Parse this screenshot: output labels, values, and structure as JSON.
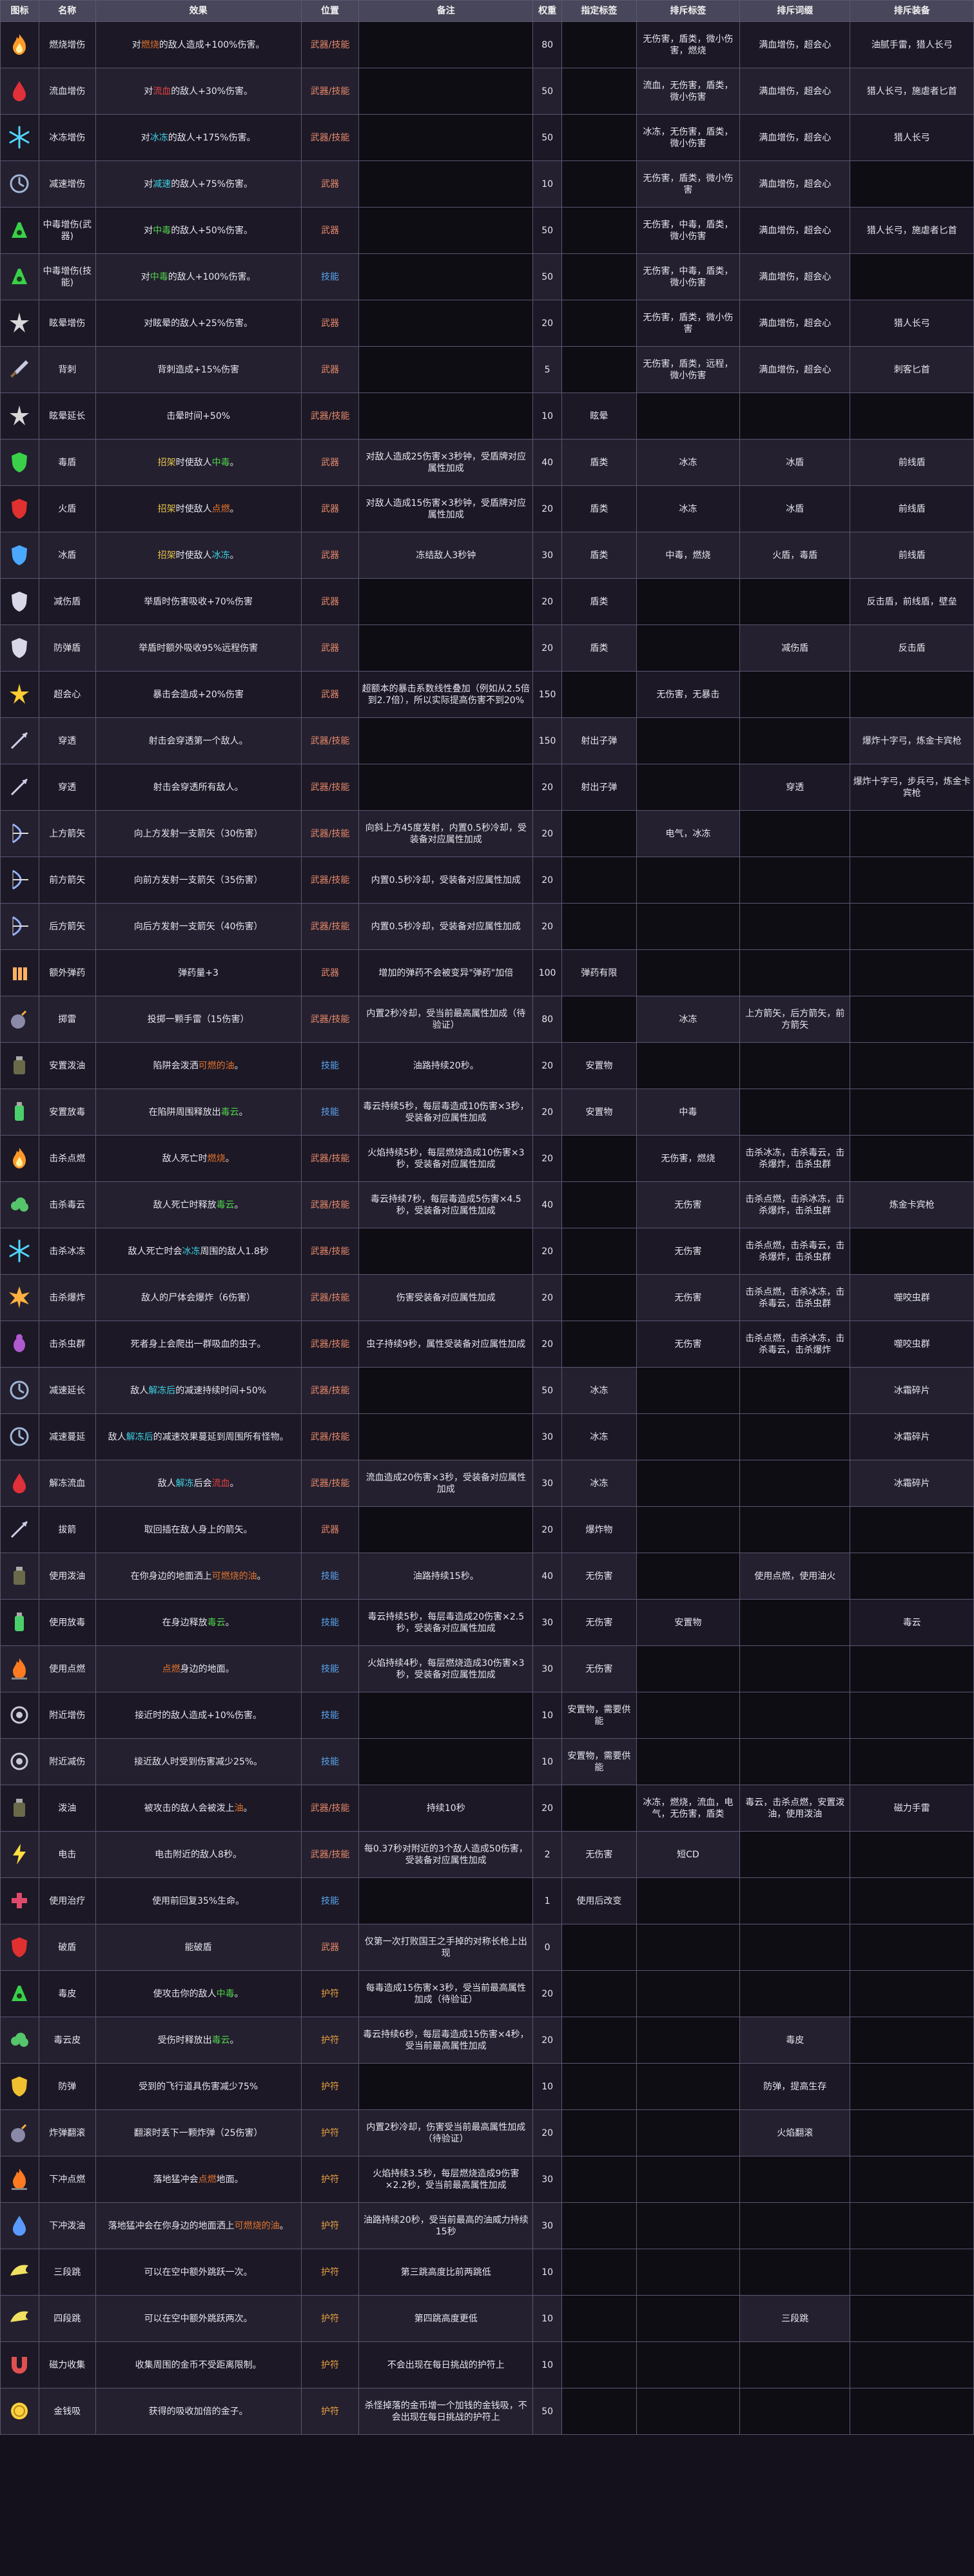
{
  "headers": [
    "图标",
    "名称",
    "效果",
    "位置",
    "备注",
    "权重",
    "指定标签",
    "排斥标签",
    "排斥词缀",
    "排斥装备"
  ],
  "rows": [
    {
      "name": "燃烧增伤",
      "effect": [
        [
          "对",
          ""
        ],
        [
          "燃烧",
          "hl-orange"
        ],
        [
          "的敌人造成+100%伤害。",
          ""
        ]
      ],
      "loc": "武器/技能",
      "note": "",
      "weight": "80",
      "tag": "",
      "ex_tag": "无伤害，盾类，微小伤害，燃烧",
      "ex_affix": "满血增伤，超会心",
      "ex_equip": "油腻手雷，猎人长弓",
      "icon": "flame"
    },
    {
      "name": "流血增伤",
      "effect": [
        [
          "对",
          ""
        ],
        [
          "流血",
          "hl-red"
        ],
        [
          "的敌人+30%伤害。",
          ""
        ]
      ],
      "loc": "武器/技能",
      "note": "",
      "weight": "50",
      "tag": "",
      "ex_tag": "流血，无伤害，盾类，微小伤害",
      "ex_affix": "满血增伤，超会心",
      "ex_equip": "猎人长弓，施虐者匕首",
      "icon": "blood"
    },
    {
      "name": "冰冻增伤",
      "effect": [
        [
          "对",
          ""
        ],
        [
          "冰冻",
          "hl-cyan"
        ],
        [
          "的敌人+175%伤害。",
          ""
        ]
      ],
      "loc": "武器/技能",
      "note": "",
      "weight": "50",
      "tag": "",
      "ex_tag": "冰冻，无伤害，盾类，微小伤害",
      "ex_affix": "满血增伤，超会心",
      "ex_equip": "猎人长弓",
      "icon": "ice"
    },
    {
      "name": "减速增伤",
      "effect": [
        [
          "对",
          ""
        ],
        [
          "减速",
          "hl-cyan"
        ],
        [
          "的敌人+75%伤害。",
          ""
        ]
      ],
      "loc": "武器",
      "note": "",
      "weight": "10",
      "tag": "",
      "ex_tag": "无伤害，盾类，微小伤害",
      "ex_affix": "满血增伤，超会心",
      "ex_equip": "",
      "icon": "slow"
    },
    {
      "name": "中毒增伤(武器)",
      "effect": [
        [
          "对",
          ""
        ],
        [
          "中毒",
          "hl-green"
        ],
        [
          "的敌人+50%伤害。",
          ""
        ]
      ],
      "loc": "武器",
      "note": "",
      "weight": "50",
      "tag": "",
      "ex_tag": "无伤害，中毒，盾类，微小伤害",
      "ex_affix": "满血增伤，超会心",
      "ex_equip": "猎人长弓，施虐者匕首",
      "icon": "poison"
    },
    {
      "name": "中毒增伤(技能)",
      "effect": [
        [
          "对",
          ""
        ],
        [
          "中毒",
          "hl-green"
        ],
        [
          "的敌人+100%伤害。",
          ""
        ]
      ],
      "loc": "技能",
      "note": "",
      "weight": "50",
      "tag": "",
      "ex_tag": "无伤害，中毒，盾类，微小伤害",
      "ex_affix": "满血增伤，超会心",
      "ex_equip": "",
      "icon": "poison"
    },
    {
      "name": "眩晕增伤",
      "effect": [
        [
          "对眩晕的敌人+25%伤害。",
          ""
        ]
      ],
      "loc": "武器",
      "note": "",
      "weight": "20",
      "tag": "",
      "ex_tag": "无伤害，盾类，微小伤害",
      "ex_affix": "满血增伤，超会心",
      "ex_equip": "猎人长弓",
      "icon": "stun"
    },
    {
      "name": "背刺",
      "effect": [
        [
          "背刺造成+15%伤害",
          ""
        ]
      ],
      "loc": "武器",
      "note": "",
      "weight": "5",
      "tag": "",
      "ex_tag": "无伤害，盾类，远程，微小伤害",
      "ex_affix": "满血增伤，超会心",
      "ex_equip": "刺客匕首",
      "icon": "dagger"
    },
    {
      "name": "眩晕延长",
      "effect": [
        [
          "击晕时间+50%",
          ""
        ]
      ],
      "loc": "武器/技能",
      "note": "",
      "weight": "10",
      "tag": "眩晕",
      "ex_tag": "",
      "ex_affix": "",
      "ex_equip": "",
      "icon": "stun"
    },
    {
      "name": "毒盾",
      "effect": [
        [
          "招架",
          "hl-yellow"
        ],
        [
          "时使敌人",
          ""
        ],
        [
          "中毒",
          "hl-green"
        ],
        [
          "。",
          ""
        ]
      ],
      "loc": "武器",
      "note": "对敌人造成25伤害×3秒钟，受盾牌对应属性加成",
      "weight": "40",
      "tag": "盾类",
      "ex_tag": "冰冻",
      "ex_affix": "冰盾",
      "ex_equip": "前线盾",
      "icon": "shield-g"
    },
    {
      "name": "火盾",
      "effect": [
        [
          "招架",
          "hl-yellow"
        ],
        [
          "时使敌人",
          ""
        ],
        [
          "点燃",
          "hl-orange"
        ],
        [
          "。",
          ""
        ]
      ],
      "loc": "武器",
      "note": "对敌人造成15伤害×3秒钟，受盾牌对应属性加成",
      "weight": "20",
      "tag": "盾类",
      "ex_tag": "冰冻",
      "ex_affix": "冰盾",
      "ex_equip": "前线盾",
      "icon": "shield-r"
    },
    {
      "name": "冰盾",
      "effect": [
        [
          "招架",
          "hl-yellow"
        ],
        [
          "时使敌人",
          ""
        ],
        [
          "冰冻",
          "hl-cyan"
        ],
        [
          "。",
          ""
        ]
      ],
      "loc": "武器",
      "note": "冻结敌人3秒钟",
      "weight": "30",
      "tag": "盾类",
      "ex_tag": "中毒，燃烧",
      "ex_affix": "火盾，毒盾",
      "ex_equip": "前线盾",
      "icon": "shield-b"
    },
    {
      "name": "减伤盾",
      "effect": [
        [
          "举盾时伤害吸收+70%伤害",
          ""
        ]
      ],
      "loc": "武器",
      "note": "",
      "weight": "20",
      "tag": "盾类",
      "ex_tag": "",
      "ex_affix": "",
      "ex_equip": "反击盾，前线盾，壁垒",
      "icon": "shield-w"
    },
    {
      "name": "防弹盾",
      "effect": [
        [
          "举盾时额外吸收95%远程伤害",
          ""
        ]
      ],
      "loc": "武器",
      "note": "",
      "weight": "20",
      "tag": "盾类",
      "ex_tag": "",
      "ex_affix": "减伤盾",
      "ex_equip": "反击盾",
      "icon": "shield-w"
    },
    {
      "name": "超会心",
      "effect": [
        [
          "暴击会造成+20%伤害",
          ""
        ]
      ],
      "loc": "武器",
      "note": "超额本的暴击系数线性叠加（例如从2.5倍到2.7倍），所以实际提高伤害不到20%",
      "weight": "150",
      "tag": "",
      "ex_tag": "无伤害，无暴击",
      "ex_affix": "",
      "ex_equip": "",
      "icon": "star"
    },
    {
      "name": "穿透",
      "effect": [
        [
          "射击会穿透第一个敌人。",
          ""
        ]
      ],
      "loc": "武器/技能",
      "note": "",
      "weight": "150",
      "tag": "射出子弹",
      "ex_tag": "",
      "ex_affix": "",
      "ex_equip": "爆炸十字弓，炼金卡宾枪",
      "icon": "arrow"
    },
    {
      "name": "穿透",
      "effect": [
        [
          "射击会穿透所有敌人。",
          ""
        ]
      ],
      "loc": "武器/技能",
      "note": "",
      "weight": "20",
      "tag": "射出子弹",
      "ex_tag": "",
      "ex_affix": "穿透",
      "ex_equip": "爆炸十字弓，步兵弓，炼金卡宾枪",
      "icon": "arrow"
    },
    {
      "name": "上方箭矢",
      "effect": [
        [
          "向上方发射一支箭矢（30伤害）",
          ""
        ]
      ],
      "loc": "武器/技能",
      "note": "向斜上方45度发射，内置0.5秒冷却，受装备对应属性加成",
      "weight": "20",
      "tag": "",
      "ex_tag": "电气，冰冻",
      "ex_affix": "",
      "ex_equip": "",
      "icon": "bow"
    },
    {
      "name": "前方箭矢",
      "effect": [
        [
          "向前方发射一支箭矢（35伤害）",
          ""
        ]
      ],
      "loc": "武器/技能",
      "note": "内置0.5秒冷却，受装备对应属性加成",
      "weight": "20",
      "tag": "",
      "ex_tag": "",
      "ex_affix": "",
      "ex_equip": "",
      "icon": "bow"
    },
    {
      "name": "后方箭矢",
      "effect": [
        [
          "向后方发射一支箭矢（40伤害）",
          ""
        ]
      ],
      "loc": "武器/技能",
      "note": "内置0.5秒冷却，受装备对应属性加成",
      "weight": "20",
      "tag": "",
      "ex_tag": "",
      "ex_affix": "",
      "ex_equip": "",
      "icon": "bow"
    },
    {
      "name": "额外弹药",
      "effect": [
        [
          "弹药量+3",
          ""
        ]
      ],
      "loc": "武器",
      "note": "增加的弹药不会被变异\"弹药\"加倍",
      "weight": "100",
      "tag": "弹药有限",
      "ex_tag": "",
      "ex_affix": "",
      "ex_equip": "",
      "icon": "ammo"
    },
    {
      "name": "掷雷",
      "effect": [
        [
          "投掷一颗手雷（15伤害）",
          ""
        ]
      ],
      "loc": "武器/技能",
      "note": "内置2秒冷却，受当前最高属性加成（待验证）",
      "weight": "80",
      "tag": "",
      "ex_tag": "冰冻",
      "ex_affix": "上方箭矢，后方箭矢，前方箭矢",
      "ex_equip": "",
      "icon": "bomb"
    },
    {
      "name": "安置泼油",
      "effect": [
        [
          "陷阱会泼洒",
          ""
        ],
        [
          "可燃的油",
          "hl-orange"
        ],
        [
          "。",
          ""
        ]
      ],
      "loc": "技能",
      "note": "油路持续20秒。",
      "weight": "20",
      "tag": "安置物",
      "ex_tag": "",
      "ex_affix": "",
      "ex_equip": "",
      "icon": "oil"
    },
    {
      "name": "安置放毒",
      "effect": [
        [
          "在陷阱周围释放出",
          ""
        ],
        [
          "毒云",
          "hl-green"
        ],
        [
          "。",
          ""
        ]
      ],
      "loc": "技能",
      "note": "毒云持续5秒，每层毒造成10伤害×3秒，受装备对应属性加成",
      "weight": "20",
      "tag": "安置物",
      "ex_tag": "中毒",
      "ex_affix": "",
      "ex_equip": "",
      "icon": "poison-b"
    },
    {
      "name": "击杀点燃",
      "effect": [
        [
          "敌人死亡时",
          ""
        ],
        [
          "燃烧",
          "hl-orange"
        ],
        [
          "。",
          ""
        ]
      ],
      "loc": "武器/技能",
      "note": "火焰持续5秒，每层燃烧造成10伤害×3秒，受装备对应属性加成",
      "weight": "20",
      "tag": "",
      "ex_tag": "无伤害，燃烧",
      "ex_affix": "击杀冰冻，击杀毒云，击杀爆炸，击杀虫群",
      "ex_equip": "",
      "icon": "flame"
    },
    {
      "name": "击杀毒云",
      "effect": [
        [
          "敌人死亡时释放",
          ""
        ],
        [
          "毒云",
          "hl-green"
        ],
        [
          "。",
          ""
        ]
      ],
      "loc": "武器/技能",
      "note": "毒云持续7秒，每层毒造成5伤害×4.5秒，受装备对应属性加成",
      "weight": "40",
      "tag": "",
      "ex_tag": "无伤害",
      "ex_affix": "击杀点燃，击杀冰冻，击杀爆炸，击杀虫群",
      "ex_equip": "炼金卡宾枪",
      "icon": "cloud"
    },
    {
      "name": "击杀冰冻",
      "effect": [
        [
          "敌人死亡时会",
          ""
        ],
        [
          "冰冻",
          "hl-cyan"
        ],
        [
          "周围的敌人1.8秒",
          ""
        ]
      ],
      "loc": "武器/技能",
      "note": "",
      "weight": "20",
      "tag": "",
      "ex_tag": "无伤害",
      "ex_affix": "击杀点燃，击杀毒云，击杀爆炸，击杀虫群",
      "ex_equip": "",
      "icon": "ice"
    },
    {
      "name": "击杀爆炸",
      "effect": [
        [
          "敌人的尸体会爆炸（6伤害）",
          ""
        ]
      ],
      "loc": "武器/技能",
      "note": "伤害受装备对应属性加成",
      "weight": "20",
      "tag": "",
      "ex_tag": "无伤害",
      "ex_affix": "击杀点燃，击杀冰冻，击杀毒云，击杀虫群",
      "ex_equip": "噬咬虫群",
      "icon": "burst"
    },
    {
      "name": "击杀虫群",
      "effect": [
        [
          "死者身上会爬出一群吸血的虫子。",
          ""
        ]
      ],
      "loc": "武器/技能",
      "note": "虫子持续9秒，属性受装备对应属性加成",
      "weight": "20",
      "tag": "",
      "ex_tag": "无伤害",
      "ex_affix": "击杀点燃，击杀冰冻，击杀毒云，击杀爆炸",
      "ex_equip": "噬咬虫群",
      "icon": "bug"
    },
    {
      "name": "减速延长",
      "effect": [
        [
          "敌人",
          ""
        ],
        [
          "解冻后",
          "hl-cyan"
        ],
        [
          "的减速持续时间+50%",
          ""
        ]
      ],
      "loc": "武器/技能",
      "note": "",
      "weight": "50",
      "tag": "冰冻",
      "ex_tag": "",
      "ex_affix": "",
      "ex_equip": "冰霜碎片",
      "icon": "slow"
    },
    {
      "name": "减速蔓延",
      "effect": [
        [
          "敌人",
          ""
        ],
        [
          "解冻后",
          "hl-cyan"
        ],
        [
          "的减速效果蔓延到周围所有怪物。",
          ""
        ]
      ],
      "loc": "武器/技能",
      "note": "",
      "weight": "30",
      "tag": "冰冻",
      "ex_tag": "",
      "ex_affix": "",
      "ex_equip": "冰霜碎片",
      "icon": "slow"
    },
    {
      "name": "解冻流血",
      "effect": [
        [
          "敌人",
          ""
        ],
        [
          "解冻",
          "hl-cyan"
        ],
        [
          "后会",
          ""
        ],
        [
          "流血",
          "hl-red"
        ],
        [
          "。",
          ""
        ]
      ],
      "loc": "武器/技能",
      "note": "流血造成20伤害×3秒，受装备对应属性加成",
      "weight": "30",
      "tag": "冰冻",
      "ex_tag": "",
      "ex_affix": "",
      "ex_equip": "冰霜碎片",
      "icon": "blood"
    },
    {
      "name": "拔箭",
      "effect": [
        [
          "取回插在敌人身上的箭矢。",
          ""
        ]
      ],
      "loc": "武器",
      "note": "",
      "weight": "20",
      "tag": "爆炸物",
      "ex_tag": "",
      "ex_affix": "",
      "ex_equip": "",
      "icon": "arrow"
    },
    {
      "name": "使用泼油",
      "effect": [
        [
          "在你身边的地面洒上",
          ""
        ],
        [
          "可燃烧的油",
          "hl-orange"
        ],
        [
          "。",
          ""
        ]
      ],
      "loc": "技能",
      "note": "油路持续15秒。",
      "weight": "40",
      "tag": "无伤害",
      "ex_tag": "",
      "ex_affix": "使用点燃，使用油火",
      "ex_equip": "",
      "icon": "oil"
    },
    {
      "name": "使用放毒",
      "effect": [
        [
          "在身边释放",
          ""
        ],
        [
          "毒云",
          "hl-green"
        ],
        [
          "。",
          ""
        ]
      ],
      "loc": "技能",
      "note": "毒云持续5秒，每层毒造成20伤害×2.5秒，受装备对应属性加成",
      "weight": "30",
      "tag": "无伤害",
      "ex_tag": "安置物",
      "ex_affix": "",
      "ex_equip": "毒云",
      "icon": "poison-b"
    },
    {
      "name": "使用点燃",
      "effect": [
        [
          "点燃",
          "hl-orange"
        ],
        [
          "身边的地面。",
          ""
        ]
      ],
      "loc": "技能",
      "note": "火焰持续4秒，每层燃烧造成30伤害×3秒，受装备对应属性加成",
      "weight": "30",
      "tag": "无伤害",
      "ex_tag": "",
      "ex_affix": "",
      "ex_equip": "",
      "icon": "flame-b"
    },
    {
      "name": "附近增伤",
      "effect": [
        [
          "接近时的敌人造成+10%伤害。",
          ""
        ]
      ],
      "loc": "技能",
      "note": "",
      "weight": "10",
      "tag": "安置物，需要供能",
      "ex_tag": "",
      "ex_affix": "",
      "ex_equip": "",
      "icon": "aura"
    },
    {
      "name": "附近减伤",
      "effect": [
        [
          "接近敌人时受到伤害减少25%。",
          ""
        ]
      ],
      "loc": "技能",
      "note": "",
      "weight": "10",
      "tag": "安置物，需要供能",
      "ex_tag": "",
      "ex_affix": "",
      "ex_equip": "",
      "icon": "aura"
    },
    {
      "name": "泼油",
      "effect": [
        [
          "被攻击的敌人会被泼上",
          ""
        ],
        [
          "油",
          "hl-orange"
        ],
        [
          "。",
          ""
        ]
      ],
      "loc": "武器/技能",
      "note": "持续10秒",
      "weight": "20",
      "tag": "",
      "ex_tag": "冰冻，燃烧，流血，电气，无伤害，盾类",
      "ex_affix": "毒云，击杀点燃，安置泼油，使用泼油",
      "ex_equip": "磁力手雷",
      "icon": "oil"
    },
    {
      "name": "电击",
      "effect": [
        [
          "电击附近的敌人8秒。",
          ""
        ]
      ],
      "loc": "武器/技能",
      "note": "每0.37秒对附近的3个敌人造成50伤害，受装备对应属性加成",
      "weight": "2",
      "tag": "无伤害",
      "ex_tag": "短CD",
      "ex_affix": "",
      "ex_equip": "",
      "icon": "bolt"
    },
    {
      "name": "使用治疗",
      "effect": [
        [
          "使用前回复35%生命。",
          ""
        ]
      ],
      "loc": "技能",
      "note": "",
      "weight": "1",
      "tag": "使用后改变",
      "ex_tag": "",
      "ex_affix": "",
      "ex_equip": "",
      "icon": "heal"
    },
    {
      "name": "破盾",
      "effect": [
        [
          "能破盾",
          ""
        ]
      ],
      "loc": "武器",
      "note": "仅第一次打败国王之手掉的对称长枪上出现",
      "weight": "0",
      "tag": "",
      "ex_tag": "",
      "ex_affix": "",
      "ex_equip": "",
      "icon": "shield-r"
    },
    {
      "name": "毒皮",
      "effect": [
        [
          "使攻击你的敌人",
          ""
        ],
        [
          "中毒",
          "hl-green"
        ],
        [
          "。",
          ""
        ]
      ],
      "loc": "护符",
      "note": "每毒造成15伤害×3秒，受当前最高属性加成（待验证）",
      "weight": "20",
      "tag": "",
      "ex_tag": "",
      "ex_affix": "",
      "ex_equip": "",
      "icon": "poison"
    },
    {
      "name": "毒云皮",
      "effect": [
        [
          "受伤时释放出",
          ""
        ],
        [
          "毒云",
          "hl-green"
        ],
        [
          "。",
          ""
        ]
      ],
      "loc": "护符",
      "note": "毒云持续6秒，每层毒造成15伤害×4秒，受当前最高属性加成",
      "weight": "20",
      "tag": "",
      "ex_tag": "",
      "ex_affix": "毒皮",
      "ex_equip": "",
      "icon": "cloud"
    },
    {
      "name": "防弹",
      "effect": [
        [
          "受到的飞行道具伤害减少75%",
          ""
        ]
      ],
      "loc": "护符",
      "note": "",
      "weight": "10",
      "tag": "",
      "ex_tag": "",
      "ex_affix": "防弹，提高生存",
      "ex_equip": "",
      "icon": "shield-y"
    },
    {
      "name": "炸弹翻滚",
      "effect": [
        [
          "翻滚时丢下一颗炸弹（25伤害）",
          ""
        ]
      ],
      "loc": "护符",
      "note": "内置2秒冷却，伤害受当前最高属性加成（待验证）",
      "weight": "20",
      "tag": "",
      "ex_tag": "",
      "ex_affix": "火焰翻滚",
      "ex_equip": "",
      "icon": "bomb"
    },
    {
      "name": "下冲点燃",
      "effect": [
        [
          "落地猛冲会",
          ""
        ],
        [
          "点燃",
          "hl-orange"
        ],
        [
          "地面。",
          ""
        ]
      ],
      "loc": "护符",
      "note": "火焰持续3.5秒，每层燃烧造成9伤害×2.2秒，受当前最高属性加成",
      "weight": "30",
      "tag": "",
      "ex_tag": "",
      "ex_affix": "",
      "ex_equip": "",
      "icon": "flame-b"
    },
    {
      "name": "下冲泼油",
      "effect": [
        [
          "落地猛冲会在你身边的地面洒上",
          ""
        ],
        [
          "可燃烧的油",
          "hl-orange"
        ],
        [
          "。",
          ""
        ]
      ],
      "loc": "护符",
      "note": "油路持续20秒，受当前最高的油威力持续15秒",
      "weight": "30",
      "tag": "",
      "ex_tag": "",
      "ex_affix": "",
      "ex_equip": "",
      "icon": "drop"
    },
    {
      "name": "三段跳",
      "effect": [
        [
          "可以在空中额外跳跃一次。",
          ""
        ]
      ],
      "loc": "护符",
      "note": "第三跳高度比前两跳低",
      "weight": "10",
      "tag": "",
      "ex_tag": "",
      "ex_affix": "",
      "ex_equip": "",
      "icon": "wing"
    },
    {
      "name": "四段跳",
      "effect": [
        [
          "可以在空中额外跳跃两次。",
          ""
        ]
      ],
      "loc": "护符",
      "note": "第四跳高度更低",
      "weight": "10",
      "tag": "",
      "ex_tag": "",
      "ex_affix": "三段跳",
      "ex_equip": "",
      "icon": "wing"
    },
    {
      "name": "磁力收集",
      "effect": [
        [
          "收集周围的金币不受距离限制。",
          ""
        ]
      ],
      "loc": "护符",
      "note": "不会出现在每日挑战的护符上",
      "weight": "10",
      "tag": "",
      "ex_tag": "",
      "ex_affix": "",
      "ex_equip": "",
      "icon": "magnet"
    },
    {
      "name": "金钱吸",
      "effect": [
        [
          "获得的吸收加倍的金子。",
          ""
        ]
      ],
      "loc": "护符",
      "note": "杀怪掉落的金币增一个加钱的金钱吸，不会出现在每日挑战的护符上",
      "weight": "50",
      "tag": "",
      "ex_tag": "",
      "ex_affix": "",
      "ex_equip": "",
      "icon": "coin"
    }
  ],
  "icon_colors": {
    "flame": "#ff9a2a",
    "blood": "#e0303a",
    "ice": "#52d6ff",
    "slow": "#9fb6d6",
    "poison": "#3ad04a",
    "stun": "#d8d8d8",
    "dagger": "#c9c9e0",
    "shield-g": "#3ad04a",
    "shield-r": "#e03030",
    "shield-b": "#4aa8ff",
    "shield-w": "#d8d8e8",
    "star": "#ffcc33",
    "arrow": "#cfcfe6",
    "bow": "#8fb0ff",
    "ammo": "#ffb060",
    "bomb": "#8a8aa8",
    "oil": "#6a6a4a",
    "poison-b": "#4ad06a",
    "cloud": "#55c46a",
    "burst": "#ffb040",
    "bug": "#b05ad0",
    "aura": "#c8c8d8",
    "bolt": "#ffe040",
    "heal": "#e04a6a",
    "shield-y": "#f0c030",
    "flame-b": "#ff7a20",
    "drop": "#5a9aff",
    "wing": "#f0e060",
    "magnet": "#e05050",
    "coin": "#ffd040"
  }
}
